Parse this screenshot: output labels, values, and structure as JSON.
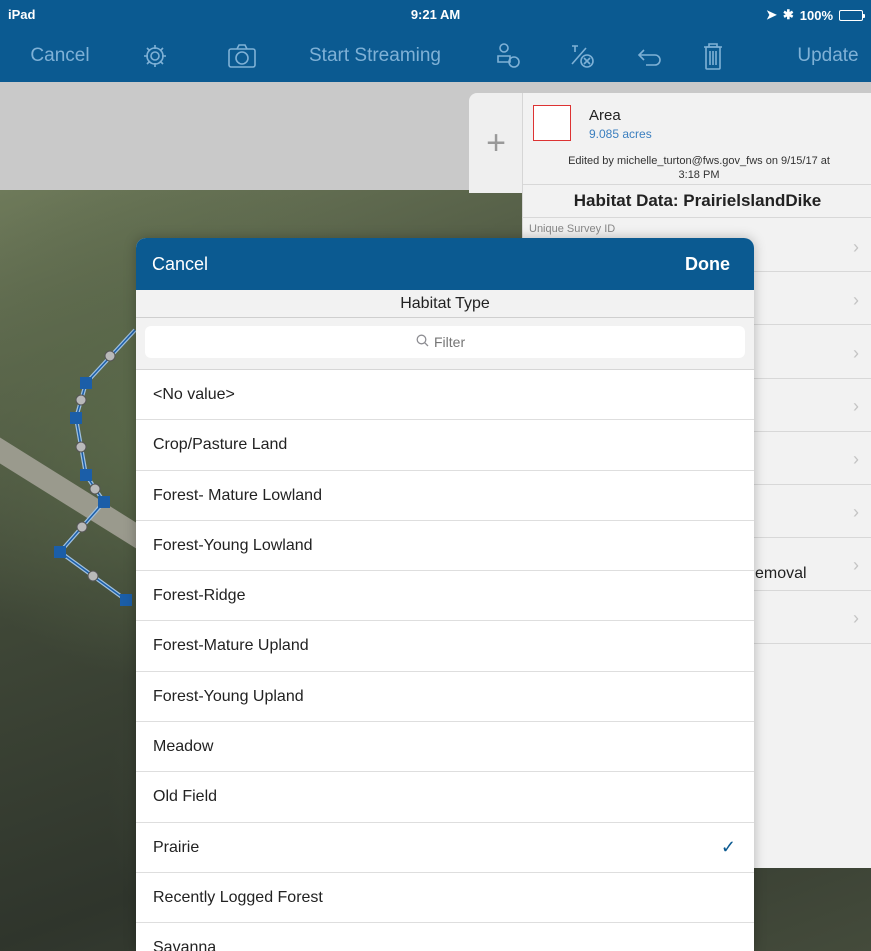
{
  "status_bar": {
    "device": "iPad",
    "time": "9:21 AM",
    "battery": "100%"
  },
  "toolbar": {
    "cancel": "Cancel",
    "start_streaming": "Start Streaming",
    "update": "Update",
    "icons": [
      "gear-icon",
      "camera-icon",
      "user-camera-icon",
      "clear-vertex-icon",
      "undo-icon",
      "trash-icon"
    ]
  },
  "side_panel": {
    "area_title": "Area",
    "area_value": "9.085 acres",
    "edited_line1": "Edited by michelle_turton@fws.gov_fws on 9/15/17 at",
    "edited_line2": "3:18 PM",
    "habitat_title": "Habitat Data: PrairielslandDike",
    "unique_id_label": "Unique Survey ID",
    "partial_value": "emoval"
  },
  "modal": {
    "cancel": "Cancel",
    "done": "Done",
    "title": "Habitat Type",
    "filter_placeholder": "Filter",
    "options": [
      {
        "label": "<No value>",
        "selected": false
      },
      {
        "label": "Crop/Pasture Land",
        "selected": false
      },
      {
        "label": "Forest- Mature Lowland",
        "selected": false
      },
      {
        "label": "Forest-Young Lowland",
        "selected": false
      },
      {
        "label": "Forest-Ridge",
        "selected": false
      },
      {
        "label": "Forest-Mature Upland",
        "selected": false
      },
      {
        "label": "Forest-Young Upland",
        "selected": false
      },
      {
        "label": "Meadow",
        "selected": false
      },
      {
        "label": "Old Field",
        "selected": false
      },
      {
        "label": "Prairie",
        "selected": true
      },
      {
        "label": "Recently Logged Forest",
        "selected": false
      },
      {
        "label": "Savanna",
        "selected": false
      }
    ]
  },
  "colors": {
    "bar_blue": "#0b5a91",
    "check_blue": "#0b5a91",
    "toolbar_text": "#7fb1d6"
  }
}
